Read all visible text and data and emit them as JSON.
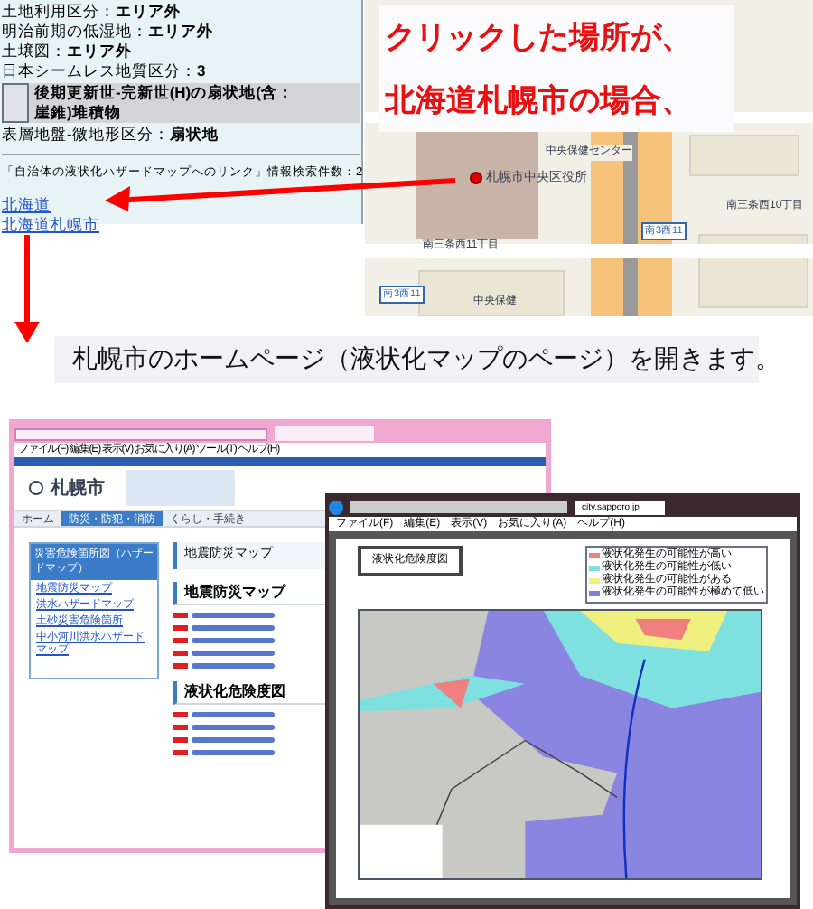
{
  "info_panel": {
    "rows": [
      {
        "label": "土地利用区分：",
        "value": "エリア外"
      },
      {
        "label": "明治前期の低湿地：",
        "value": "エリア外"
      },
      {
        "label": "土壌図：",
        "value": "エリア外"
      },
      {
        "label": "日本シームレス地質区分：",
        "value": "3"
      }
    ],
    "legend_text": "後期更新世-完新世(H)の扇状地(含：崖錐)堆積物",
    "landform": {
      "label": "表層地盤-微地形区分：",
      "value": "扇状地"
    },
    "search_result": "「自治体の液状化ハザードマップへのリンク」情報検索件数：2",
    "links": [
      "北海道",
      "北海道札幌市"
    ]
  },
  "map": {
    "office": "札幌市中央区役所",
    "labels": [
      "中央保健センター",
      "南三条西11丁目",
      "南三条西10丁目",
      "中央保健"
    ],
    "station_badges": [
      "南3西11",
      "南3西11"
    ],
    "callout": [
      "クリックした場所が、",
      "北海道札幌市の場合、"
    ]
  },
  "caption": "札幌市のホームページ（液状化マップのページ）を開きます。",
  "city_site": {
    "menu": [
      "ファイル(F)",
      "編集(E)",
      "表示(V)",
      "お気に入り(A)",
      "ツール(T)",
      "ヘルプ(H)"
    ],
    "logo": "札幌市",
    "nav": [
      {
        "label": "ホーム",
        "selected": false
      },
      {
        "label": "防災・防犯・消防",
        "selected": true
      },
      {
        "label": "くらし・手続き",
        "selected": false
      }
    ],
    "sidebar_title": "災害危険箇所図（ハザードマップ）",
    "sidebar_items": [
      "地震防災マップ",
      "洪水ハザードマップ",
      "土砂災害危険箇所",
      "中小河川洪水ハザードマップ"
    ],
    "page_title": "地震防災マップ",
    "sections": [
      {
        "title": "地震防災マップ"
      },
      {
        "title": "液状化危険度図"
      }
    ]
  },
  "map_viewer": {
    "menu": [
      "ファイル(F)",
      "編集(E)",
      "表示(V)",
      "お気に入り(A)",
      "ヘルプ(H)"
    ],
    "tab": "city.sapporo.jp",
    "title": "液状化危険度図",
    "legend": [
      {
        "label": "液状化発生の可能性が高い",
        "color": "#f08080"
      },
      {
        "label": "液状化発生の可能性が低い",
        "color": "#7fe0e0"
      },
      {
        "label": "液状化発生の可能性がある",
        "color": "#f0f080"
      },
      {
        "label": "液状化発生の可能性が極めて低い",
        "color": "#8080e0"
      }
    ]
  }
}
